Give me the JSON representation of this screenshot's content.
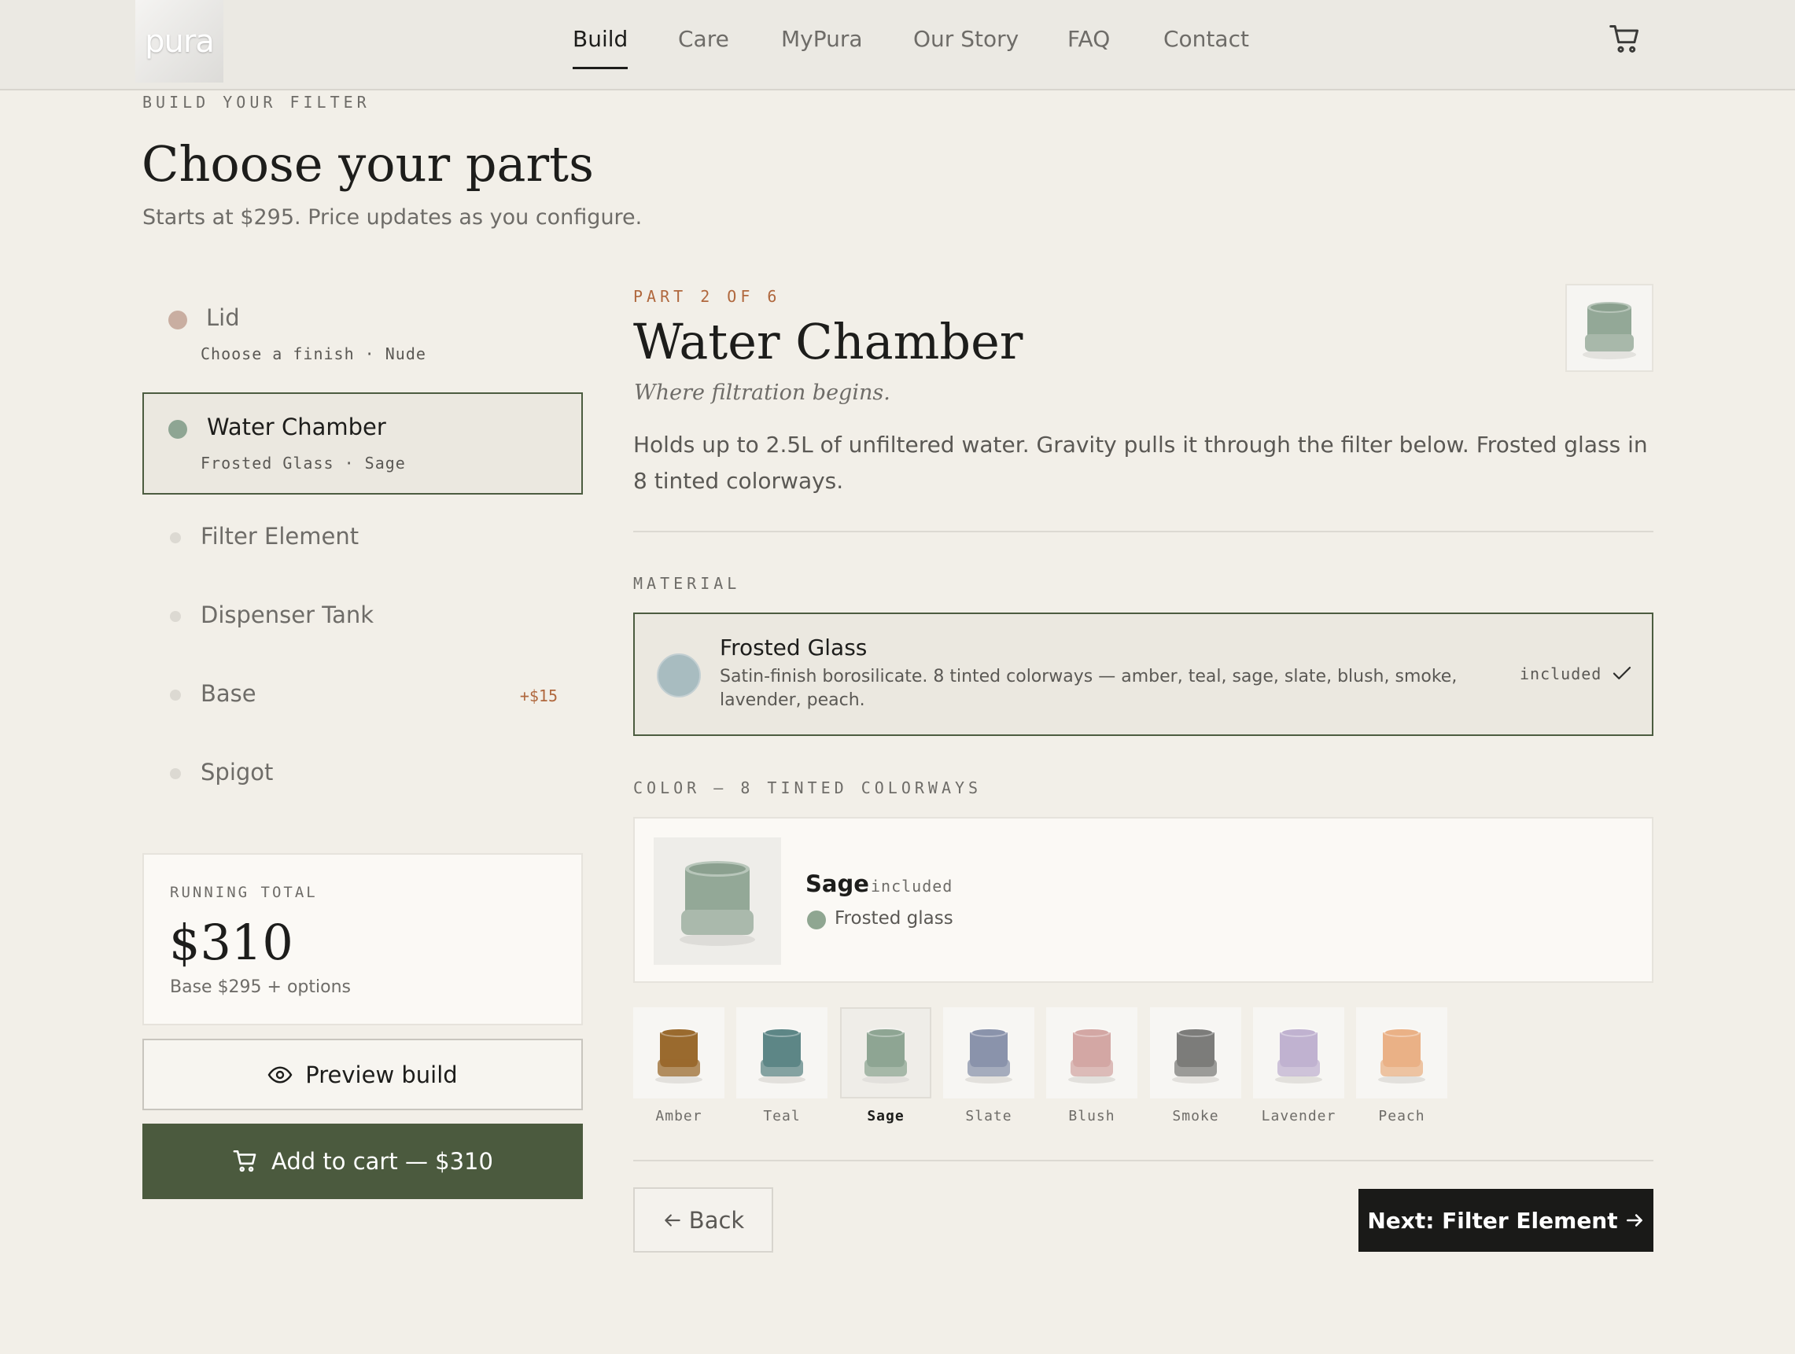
{
  "header": {
    "logo_text": "pura",
    "nav": [
      {
        "label": "Build",
        "active": true
      },
      {
        "label": "Care",
        "active": false
      },
      {
        "label": "MyPura",
        "active": false
      },
      {
        "label": "Our Story",
        "active": false
      },
      {
        "label": "FAQ",
        "active": false
      },
      {
        "label": "Contact",
        "active": false
      }
    ],
    "cart_icon": "cart-icon"
  },
  "intro": {
    "eyebrow": "BUILD YOUR FILTER",
    "title": "Choose your parts",
    "subtitle": "Starts at $295. Price updates as you configure."
  },
  "parts": [
    {
      "name": "Lid",
      "sub": "Choose a finish · Nude",
      "color": "#c9aea1",
      "state": "done"
    },
    {
      "name": "Water Chamber",
      "sub": "Frosted Glass · Sage",
      "color": "#8ea593",
      "state": "active"
    },
    {
      "name": "Filter Element",
      "state": "pending"
    },
    {
      "name": "Dispenser Tank",
      "state": "pending"
    },
    {
      "name": "Base",
      "price": "+$15",
      "state": "pending"
    },
    {
      "name": "Spigot",
      "state": "pending"
    }
  ],
  "total": {
    "label": "RUNNING TOTAL",
    "value": "$310",
    "note": "Base $295 + options"
  },
  "actions": {
    "preview_label": "Preview build",
    "cart_label": "Add to cart — $310",
    "back_label": "Back",
    "next_label": "Next: Filter Element"
  },
  "detail": {
    "eyebrow": "PART 2 OF 6",
    "title": "Water Chamber",
    "tagline": "Where filtration begins.",
    "description": "Holds up to 2.5L of unfiltered water. Gravity pulls it through the filter below. Frosted glass in 8 tinted colorways."
  },
  "material": {
    "section_label": "MATERIAL",
    "name": "Frosted Glass",
    "description": "Satin-finish borosilicate. 8 tinted colorways — amber, teal, sage, slate, blush, smoke, lavender, peach.",
    "included": "included",
    "swatch_color": "#a8bcc0"
  },
  "color": {
    "section_label": "COLOR — 8 TINTED COLORWAYS",
    "selected_name": "Sage",
    "selected_included": "included",
    "selected_material": "Frosted glass",
    "swatches": [
      {
        "label": "Amber",
        "color": "#9a6a2e",
        "selected": false
      },
      {
        "label": "Teal",
        "color": "#5d8686",
        "selected": false
      },
      {
        "label": "Sage",
        "color": "#8ea593",
        "selected": true
      },
      {
        "label": "Slate",
        "color": "#8a93ab",
        "selected": false
      },
      {
        "label": "Blush",
        "color": "#d3a7a4",
        "selected": false
      },
      {
        "label": "Smoke",
        "color": "#7c7c7a",
        "selected": false
      },
      {
        "label": "Lavender",
        "color": "#c0b2d0",
        "selected": false
      },
      {
        "label": "Peach",
        "color": "#eab186",
        "selected": false
      }
    ]
  }
}
